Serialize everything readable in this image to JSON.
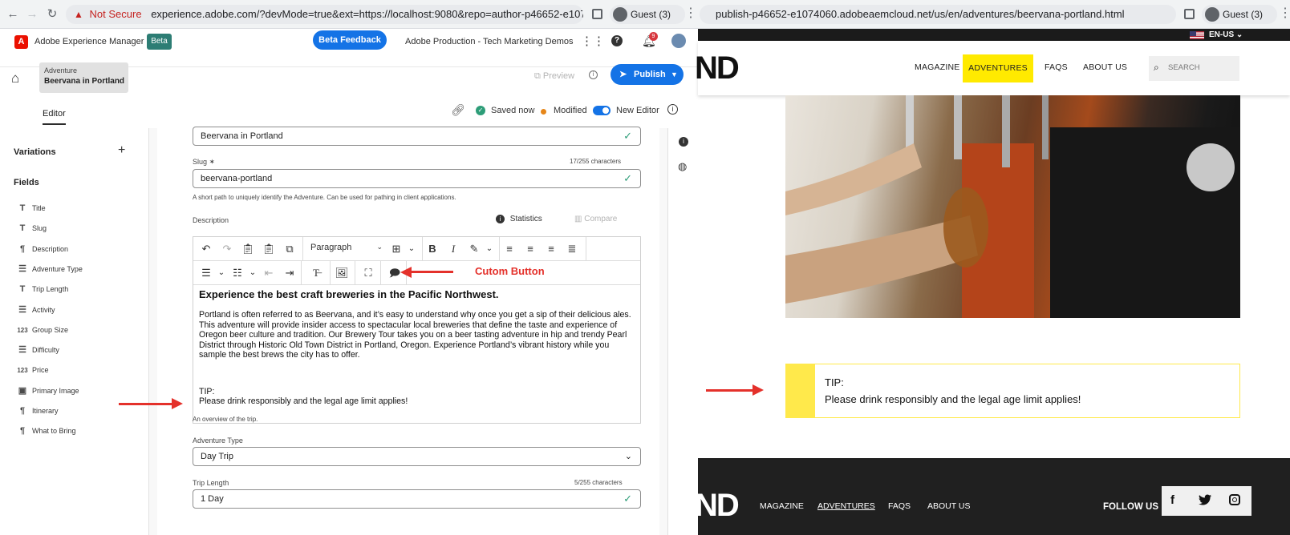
{
  "left_browser": {
    "security": "Not Secure",
    "url": "experience.adobe.com/?devMode=true&ext=https://localhost:9080&repo=author-p46652-e1074060...",
    "profile": "Guest (3)"
  },
  "right_browser": {
    "url": "publish-p46652-e1074060.adobeaemcloud.net/us/en/adventures/beervana-portland.html",
    "profile": "Guest (3)"
  },
  "aem": {
    "product": "Adobe Experience Manager",
    "beta_badge": "Beta",
    "feedback_button": "Beta Feedback",
    "org": "Adobe Production - Tech Marketing Demos",
    "notification_count": "9",
    "breadcrumb_type": "Adventure",
    "breadcrumb_title": "Beervana in Portland",
    "preview": "Preview",
    "publish": "Publish",
    "tab_editor": "Editor",
    "status_saved": "Saved now",
    "status_modified": "Modified",
    "new_editor": "New Editor",
    "variations": "Variations",
    "fields_heading": "Fields",
    "fields": [
      {
        "icon": "T",
        "label": "Title"
      },
      {
        "icon": "T",
        "label": "Slug"
      },
      {
        "icon": "¶",
        "label": "Description"
      },
      {
        "icon": "☰",
        "label": "Adventure Type"
      },
      {
        "icon": "T",
        "label": "Trip Length"
      },
      {
        "icon": "☰",
        "label": "Activity"
      },
      {
        "icon": "123",
        "label": "Group Size"
      },
      {
        "icon": "☰",
        "label": "Difficulty"
      },
      {
        "icon": "123",
        "label": "Price"
      },
      {
        "icon": "▣",
        "label": "Primary Image"
      },
      {
        "icon": "¶",
        "label": "Itinerary"
      },
      {
        "icon": "¶",
        "label": "What to Bring"
      }
    ],
    "form": {
      "title_value": "Beervana in Portland",
      "slug_label": "Slug ✶",
      "slug_count": "17/255 characters",
      "slug_value": "beervana-portland",
      "slug_help": "A short path to uniquely identify the Adventure. Can be used for pathing in client applications.",
      "description_label": "Description",
      "statistics": "Statistics",
      "compare": "Compare",
      "paragraph_select": "Paragraph",
      "custom_button_annotation": "Cutom Button",
      "rte_heading": "Experience the best craft breweries in the Pacific Northwest.",
      "rte_body": "Portland is often referred to as Beervana, and it’s easy to understand why once you get a sip of their delicious ales.  This adventure will provide insider access to spectacular local breweries that define the taste and experience of Oregon beer culture and tradition.   Our Brewery Tour takes you on a beer tasting adventure in hip and trendy Pearl District through Historic Old Town District in Portland, Oregon. Experience Portland’s vibrant history while you sample the best brews the city has to offer.",
      "rte_tip_label": "TIP:",
      "rte_tip_text": "Please drink responsibly and the legal age limit applies!",
      "description_help": "An overview of the trip.",
      "adventure_type_label": "Adventure Type",
      "adventure_type_value": "Day Trip",
      "trip_length_label": "Trip Length",
      "trip_length_count": "5/255 characters",
      "trip_length_value": "1 Day"
    }
  },
  "publish": {
    "locale": "EN-US",
    "logo_fragment": "ND",
    "nav": [
      "MAGAZINE",
      "ADVENTURES",
      "FAQS",
      "ABOUT US"
    ],
    "search_placeholder": "SEARCH",
    "tip_label": "TIP:",
    "tip_text": "Please drink responsibly and the legal age limit applies!",
    "footer_nav": [
      "MAGAZINE",
      "ADVENTURES",
      "FAQS",
      "ABOUT US"
    ],
    "follow_us": "FOLLOW US"
  },
  "colors": {
    "adobe_red": "#eb1000",
    "accent_blue": "#1473e6",
    "adventures_yellow": "#ffea00",
    "tip_yellow": "#ffe94b",
    "annotation_red": "#e4312b"
  }
}
